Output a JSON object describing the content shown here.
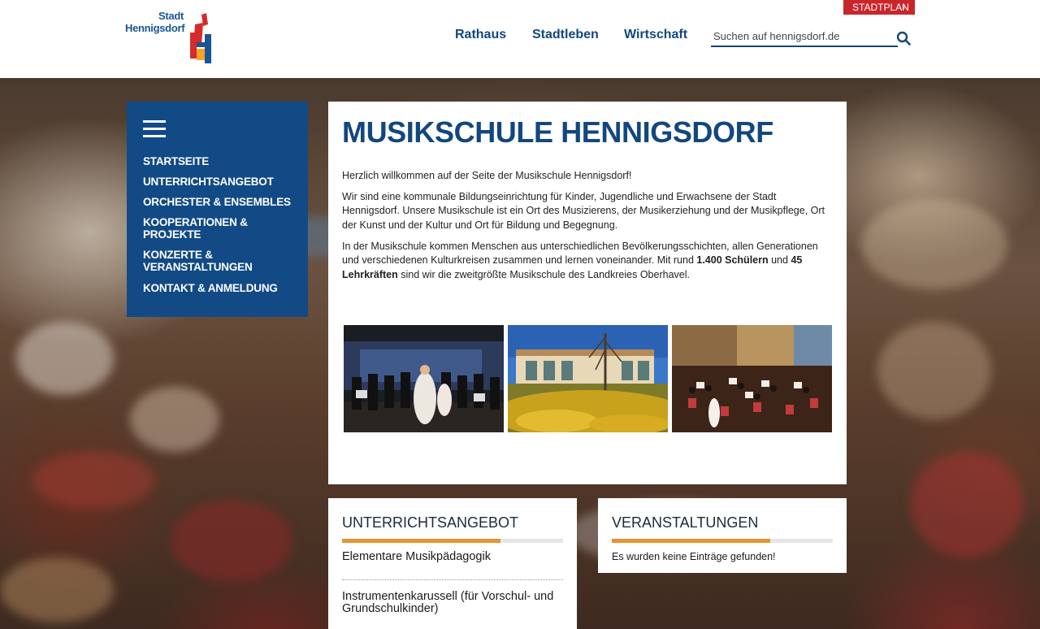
{
  "header": {
    "logo_line1": "Stadt",
    "logo_line2": "Hennigsdorf",
    "stadtplan_label": "STADTPLAN",
    "nav": [
      "Rathaus",
      "Stadtleben",
      "Wirtschaft"
    ],
    "search_placeholder": "Suchen auf hennigsdorf.de"
  },
  "sidebar": {
    "items": [
      "STARTSEITE",
      "UNTERRICHTSANGEBOT",
      "ORCHESTER & ENSEMBLES",
      "KOOPERATIONEN & PROJEKTE",
      "KONZERTE & VERANSTALTUNGEN",
      "KONTAKT & ANMELDUNG"
    ]
  },
  "main": {
    "title": "MUSIKSCHULE HENNIGSDORF",
    "welcome": "Herzlich willkommen auf der Seite der Musikschule Hennigsdorf!",
    "intro": "Wir sind eine kommunale Bildungseinrichtung für Kinder, Jugendliche und Erwachsene der Stadt Hennigsdorf. Unsere Musikschule ist ein Ort des Musizierens, der Musikerziehung und der Musikpflege, Ort der Kunst und der Kultur und Ort für Bildung und Begegnung.",
    "para3_a": "In der Musikschule kommen Menschen aus unterschiedlichen Bevölkerungsschichten, allen Generationen und verschiedenen Kulturkreisen zusammen und lernen voneinander. Mit rund ",
    "para3_students": "1.400 Schülern",
    "para3_and": " und ",
    "para3_teachers": "45 Lehrkräften",
    "para3_b": " sind wir die zweitgrößte Musikschule des Landkreies Oberhavel."
  },
  "boxes": {
    "left": {
      "title": "UNTERRICHTSANGEBOT",
      "links": [
        "Elementare Musikpädagogik",
        "Instrumentenkarussell (für Vorschul- und Grundschulkinder)"
      ]
    },
    "right": {
      "title": "VERANSTALTUNGEN",
      "empty_text": "Es wurden keine Einträge gefunden!"
    }
  },
  "colors": {
    "brand_blue": "#124a86",
    "accent_orange": "#e8942e",
    "stadtplan_red": "#c9262c"
  }
}
